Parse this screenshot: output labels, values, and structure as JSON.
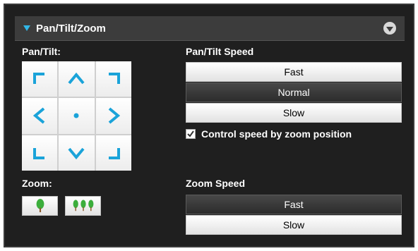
{
  "header": {
    "title": "Pan/Tilt/Zoom",
    "collapse_icon": "chevron-down-circle-icon"
  },
  "pan_tilt": {
    "label": "Pan/Tilt:",
    "pad_icons": [
      "arrow-up-left-icon",
      "arrow-up-icon",
      "arrow-up-right-icon",
      "arrow-left-icon",
      "home-dot-icon",
      "arrow-right-icon",
      "arrow-down-left-icon",
      "arrow-down-icon",
      "arrow-down-right-icon"
    ],
    "accent": "#1aa3d9"
  },
  "pan_tilt_speed": {
    "label": "Pan/Tilt Speed",
    "options": [
      "Fast",
      "Normal",
      "Slow"
    ],
    "selected": "Normal"
  },
  "zoom_checkbox": {
    "label": "Control speed by zoom position",
    "checked": true
  },
  "zoom": {
    "label": "Zoom:",
    "buttons": [
      "zoom-in-tree-icon",
      "zoom-out-trees-icon"
    ],
    "tree_color": "#3cae3c"
  },
  "zoom_speed": {
    "label": "Zoom Speed",
    "options": [
      "Fast",
      "Slow"
    ],
    "selected": "Fast"
  }
}
